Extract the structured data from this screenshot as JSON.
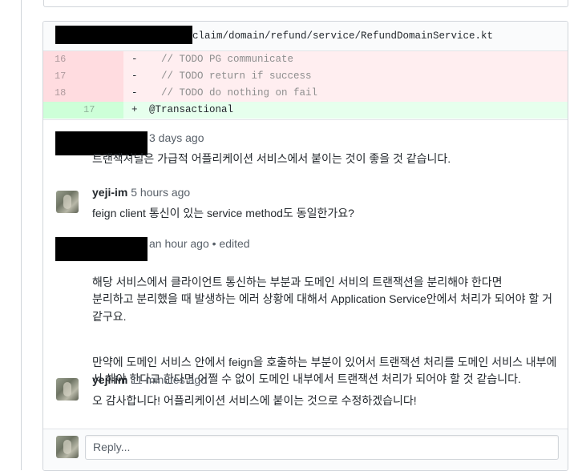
{
  "file": {
    "path": "claim/domain/refund/service/RefundDomainService.kt"
  },
  "diff": {
    "rows": [
      {
        "type": "del",
        "old": "16",
        "new": "",
        "sign": "-",
        "code": "  // TODO PG communicate"
      },
      {
        "type": "del",
        "old": "17",
        "new": "",
        "sign": "-",
        "code": "  // TODO return if success"
      },
      {
        "type": "del",
        "old": "18",
        "new": "",
        "sign": "-",
        "code": "  // TODO do nothing on fail"
      },
      {
        "type": "add",
        "old": "",
        "new": "17",
        "sign": "+",
        "code": "@Transactional"
      }
    ]
  },
  "comments": [
    {
      "author": "",
      "time": "3 days ago",
      "edited": "",
      "body": [
        "트랜잭셔널은 가급적 어플리케이션 서비스에서 붙이는 것이 좋을 것 같습니다."
      ]
    },
    {
      "author": "yeji-im",
      "time": "5 hours ago",
      "edited": "",
      "body": [
        "feign client 통신이 있는 service method도 동일한가요?"
      ]
    },
    {
      "author": "",
      "time": "an hour ago",
      "edited": "• edited",
      "body": [
        "해당 서비스에서 클라이언트 통신하는 부분과 도메인 서비의 트랜잭션을 분리해야 한다면\n분리하고 분리했을 때 발생하는 에러 상황에 대해서 Application Service안에서 처리가 되어야 할 거 같구요.",
        "만약에 도메인 서비스 안에서 feign을 호출하는 부분이 있어서 트랜잭션 처리를 도메인 서비스 내부에서 해야 한다고 한다면 어쩔 수 없이 도메인 내부에서 트랜잭션 처리가 되어야 할 것 같습니다."
      ]
    },
    {
      "author": "yeji-im",
      "time": "11 minutes ago",
      "edited": "",
      "body": [
        "오 감사합니다! 어플리케이션 서비스에 붙이는 것으로 수정하겠습니다!"
      ]
    }
  ],
  "reply": {
    "placeholder": "Reply..."
  }
}
